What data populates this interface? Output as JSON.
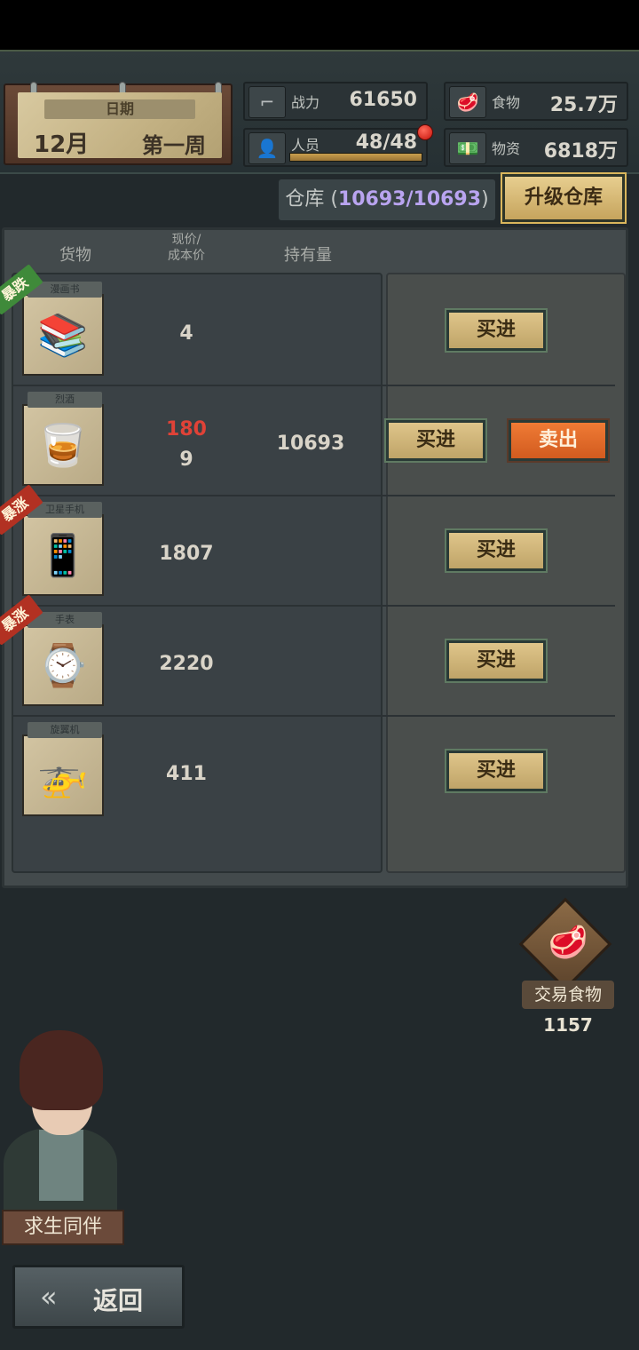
{
  "date": {
    "label": "日期",
    "month": "12月",
    "week": "第一周"
  },
  "stats": {
    "power": {
      "name": "战力",
      "value": "61650",
      "icon": "gun-icon"
    },
    "people": {
      "name": "人员",
      "value": "48/48",
      "icon": "person-icon",
      "fill": 1.0
    },
    "food": {
      "name": "食物",
      "value": "25.7万",
      "icon": "meat-icon"
    },
    "supplies": {
      "name": "物资",
      "value": "6818万",
      "icon": "cash-icon"
    }
  },
  "warehouse": {
    "label": "仓库",
    "open": "(",
    "capacity": "10693/10693",
    "close": ")",
    "upgrade": "升级仓库"
  },
  "table": {
    "headers": {
      "goods": "货物",
      "price_top": "现价/",
      "price_bottom": "成本价",
      "holding": "持有量"
    },
    "rows": [
      {
        "caption": "漫画书",
        "icon": "comic-book-icon",
        "glyph": "📚",
        "tag": "暴跌",
        "tag_type": "down",
        "price": "4",
        "cost": "",
        "holding": "",
        "buy": "买进",
        "sell": ""
      },
      {
        "caption": "烈酒",
        "icon": "whiskey-bottle-icon",
        "glyph": "🥃",
        "tag": "",
        "tag_type": "",
        "price": "180",
        "cost": "9",
        "holding": "10693",
        "buy": "买进",
        "sell": "卖出"
      },
      {
        "caption": "卫星手机",
        "icon": "satellite-phone-icon",
        "glyph": "📱",
        "tag": "暴涨",
        "tag_type": "up",
        "price": "1807",
        "cost": "",
        "holding": "",
        "buy": "买进",
        "sell": ""
      },
      {
        "caption": "手表",
        "icon": "wristwatch-icon",
        "glyph": "⌚",
        "tag": "暴涨",
        "tag_type": "up",
        "price": "2220",
        "cost": "",
        "holding": "",
        "buy": "买进",
        "sell": ""
      },
      {
        "caption": "旋翼机",
        "icon": "gyrocopter-icon",
        "glyph": "🚁",
        "tag": "",
        "tag_type": "",
        "price": "411",
        "cost": "",
        "holding": "",
        "buy": "买进",
        "sell": ""
      }
    ]
  },
  "trade_food": {
    "label": "交易食物",
    "count": "1157",
    "icon": "meat-cash-icon"
  },
  "companion": {
    "label": "求生同伴"
  },
  "back": {
    "label": "返回",
    "icon": "double-left-arrow-icon"
  },
  "colors": {
    "buy": "#dfc58a",
    "sell": "#ef7b35",
    "tag_down": "#3f8a3a",
    "tag_up": "#b23122",
    "capacity": "#b9a4f0",
    "price_red": "#e04237"
  }
}
